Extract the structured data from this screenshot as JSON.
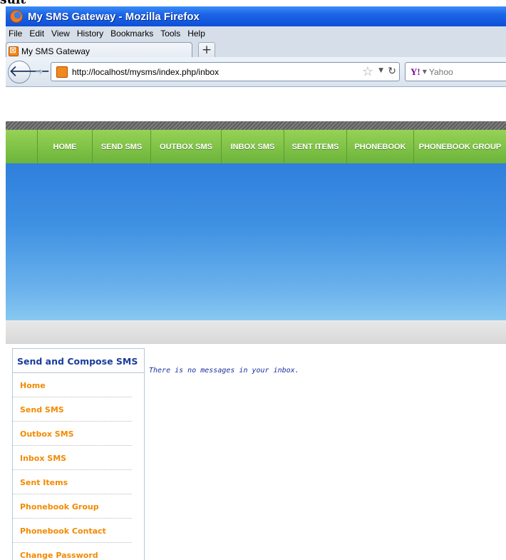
{
  "caption_fragment": "sult",
  "window": {
    "title": "My SMS Gateway - Mozilla Firefox"
  },
  "menubar": {
    "items": [
      "File",
      "Edit",
      "View",
      "History",
      "Bookmarks",
      "Tools",
      "Help"
    ]
  },
  "tabs": [
    {
      "label": "My SMS Gateway"
    }
  ],
  "newtab_label": "+",
  "addressbar": {
    "url": "http://localhost/mysms/index.php/inbox"
  },
  "searchbar": {
    "placeholder": "Yahoo",
    "engine": "Y!"
  },
  "site_nav": [
    "HOME",
    "SEND SMS",
    "OUTBOX SMS",
    "INBOX SMS",
    "SENT ITEMS",
    "PHONEBOOK",
    "PHONEBOOK GROUP"
  ],
  "sidebar": {
    "title": "Send and Compose SMS",
    "items": [
      "Home",
      "Send SMS",
      "Outbox SMS",
      "Inbox SMS",
      "Sent Items",
      "Phonebook Group",
      "Phonebook Contact",
      "Change Password"
    ]
  },
  "content": {
    "message": "There is no messages in your inbox."
  },
  "colors": {
    "nav_green": "#7ec14a",
    "sidebar_link": "#f28a00",
    "sidebar_title": "#1a3d9b",
    "message_text": "#1a2fa0"
  }
}
